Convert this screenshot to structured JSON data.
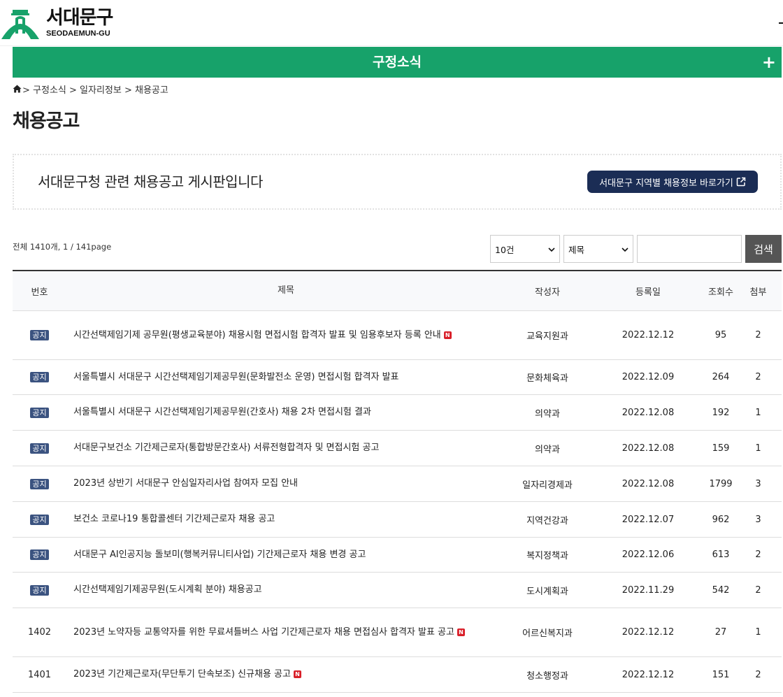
{
  "brand": {
    "name": "서대문구",
    "english": "SEODAEMUN-GU",
    "accent": "#17a26a",
    "navy": "#1b2d55"
  },
  "section": {
    "title": "구정소식",
    "plus": "+"
  },
  "breadcrumb": {
    "path": "> 구정소식 > 일자리정보 > 채용공고"
  },
  "page": {
    "title": "채용공고"
  },
  "intro": {
    "text": "서대문구청 관련 채용공고 게시판입니다",
    "button_label": "서대문구 지역별 채용정보 바로가기"
  },
  "search": {
    "total_label": "전체 1410개, 1 / 141page",
    "per_page": "10건",
    "field": "제목",
    "query": "",
    "button_label": "검색"
  },
  "table": {
    "headers": {
      "num": "번호",
      "title": "제목",
      "author": "작성자",
      "date": "등록일",
      "views": "조회수",
      "attach": "첨부"
    },
    "notice_label": "공지",
    "new_label": "N",
    "rows": [
      {
        "num": "",
        "notice": true,
        "title": "시간선택제임기제 공무원(평생교육분야) 채용시험 면접시험 합격자 발표 및 임용후보자 등록 안내",
        "is_new": true,
        "author": "교육지원과",
        "date": "2022.12.12",
        "views": "95",
        "attach": "2"
      },
      {
        "num": "",
        "notice": true,
        "title": "서울특별시 서대문구 시간선택제임기제공무원(문화발전소 운영) 면접시험 합격자 발표",
        "is_new": false,
        "author": "문화체육과",
        "date": "2022.12.09",
        "views": "264",
        "attach": "2"
      },
      {
        "num": "",
        "notice": true,
        "title": "서울특별시 서대문구 시간선택제임기제공무원(간호사) 채용 2차 면접시험 결과",
        "is_new": false,
        "author": "의약과",
        "date": "2022.12.08",
        "views": "192",
        "attach": "1"
      },
      {
        "num": "",
        "notice": true,
        "title": "서대문구보건소 기간제근로자(통합방문간호사) 서류전형합격자 및 면접시험 공고",
        "is_new": false,
        "author": "의약과",
        "date": "2022.12.08",
        "views": "159",
        "attach": "1"
      },
      {
        "num": "",
        "notice": true,
        "title": "2023년 상반기 서대문구 안심일자리사업 참여자 모집 안내",
        "is_new": false,
        "author": "일자리경제과",
        "date": "2022.12.08",
        "views": "1799",
        "attach": "3"
      },
      {
        "num": "",
        "notice": true,
        "title": "보건소 코로나19 통합콜센터 기간제근로자 채용 공고",
        "is_new": false,
        "author": "지역건강과",
        "date": "2022.12.07",
        "views": "962",
        "attach": "3"
      },
      {
        "num": "",
        "notice": true,
        "title": "서대문구 AI인공지능 돌보미(행복커뮤니티사업) 기간제근로자 채용 변경 공고",
        "is_new": false,
        "author": "복지정책과",
        "date": "2022.12.06",
        "views": "613",
        "attach": "2"
      },
      {
        "num": "",
        "notice": true,
        "title": "시간선택제임기제공무원(도시계획 분야) 채용공고",
        "is_new": false,
        "author": "도시계획과",
        "date": "2022.11.29",
        "views": "542",
        "attach": "2"
      },
      {
        "num": "1402",
        "notice": false,
        "title": "2023년 노약자등 교통약자를 위한 무료셔틀버스 사업 기간제근로자 채용 면접심사 합격자 발표 공고",
        "is_new": true,
        "author": "어르신복지과",
        "date": "2022.12.12",
        "views": "27",
        "attach": "1"
      },
      {
        "num": "1401",
        "notice": false,
        "title": "2023년 기간제근로자(무단투기 단속보조) 신규채용 공고",
        "is_new": true,
        "author": "청소행정과",
        "date": "2022.12.12",
        "views": "151",
        "attach": "2"
      }
    ]
  }
}
